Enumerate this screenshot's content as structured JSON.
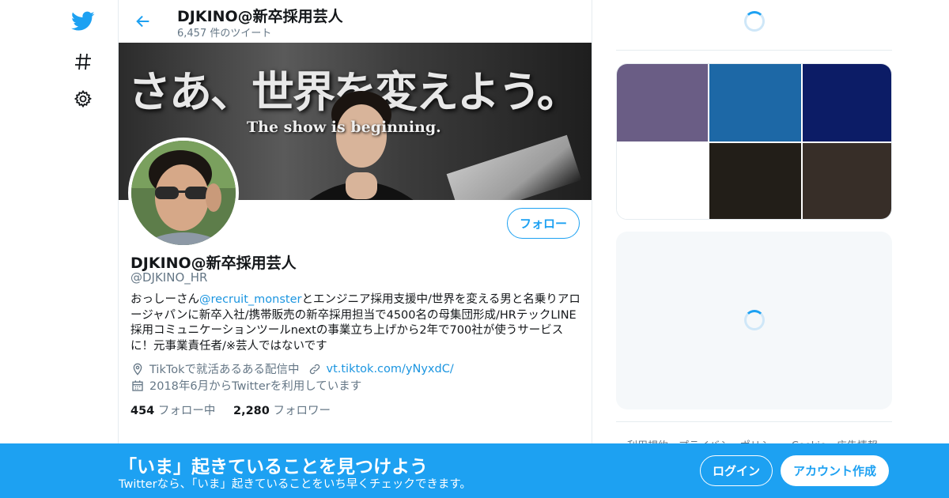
{
  "colors": {
    "accent": "#1da1f2",
    "link": "#1b95e0",
    "text": "#14171a",
    "muted": "#657786",
    "border": "#e6ecf0"
  },
  "nav": {
    "icons": [
      "twitter-bird-icon",
      "hashtag-icon",
      "gear-icon"
    ]
  },
  "header": {
    "title": "DJKINO@新卒採用芸人",
    "tweet_count": "6,457 件のツイート"
  },
  "banner": {
    "headline": "さあ、世界を変えよう。",
    "subline": "The show is beginning."
  },
  "profile": {
    "name": "DJKINO@新卒採用芸人",
    "handle": "@DJKINO_HR",
    "follow_label": "フォロー",
    "bio": {
      "before": "おっしーさん",
      "mention": "@recruit_monster",
      "after": "とエンジニア採用支援中/世界を変える男と名乗りアロージャパンに新卒入社/携帯販売の新卒採用担当で4500名の母集団形成/HRテックLINE採用コミュニケーションツールnextの事業立ち上げから2年で700社が使うサービスに！元事業責任者/※芸人ではないです"
    },
    "location": "TikTokで就活あるある配信中",
    "website": "vt.tiktok.com/yNyxdC/",
    "joined": "2018年6月からTwitterを利用しています",
    "following_count": "454",
    "following_label": "フォロー中",
    "followers_count": "2,280",
    "followers_label": "フォロワー"
  },
  "sidebar": {
    "media_colors": [
      "#6a5d85",
      "#1d68a6",
      "#0c1c66",
      "#ffffff",
      "#221e18",
      "#372e28"
    ],
    "footer": "利用規約　プライバシーポリシー　Cookie　広告情報"
  },
  "bottom_bar": {
    "title": "「いま」起きていることを見つけよう",
    "subtitle": "Twitterなら、「いま」起きていることをいち早くチェックできます。",
    "login_label": "ログイン",
    "signup_label": "アカウント作成"
  }
}
